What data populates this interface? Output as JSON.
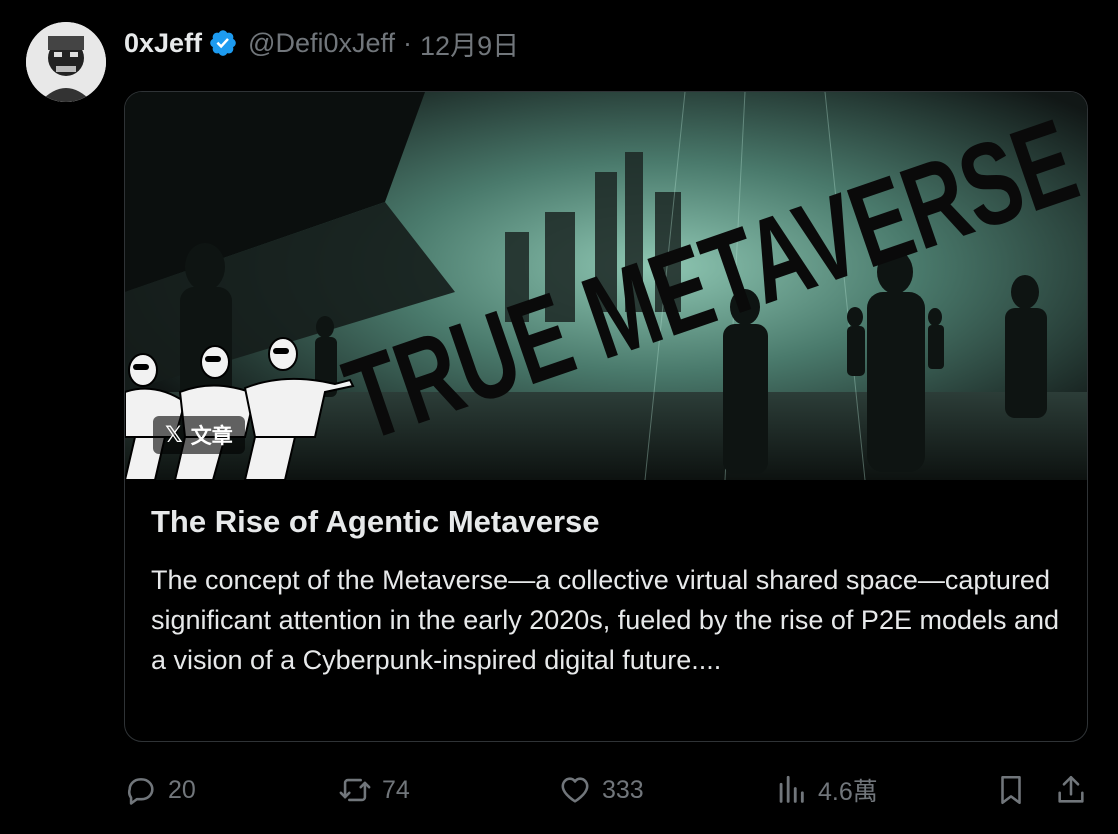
{
  "tweet": {
    "author_name": "0xJeff",
    "handle": "@Defi0xJeff",
    "separator": "·",
    "date": "12月9日",
    "verified": true
  },
  "article": {
    "cover_text": "TRUE METAVERSE",
    "badge_logo": "𝕏",
    "badge_label": "文章",
    "title": "The Rise of Agentic Metaverse",
    "excerpt": "The concept of the Metaverse—a collective virtual shared space—captured significant attention in the early 2020s, fueled by the rise of P2E models and a vision of a Cyberpunk-inspired digital future...."
  },
  "actions": {
    "replies": "20",
    "reposts": "74",
    "likes": "333",
    "views": "4.6萬"
  },
  "icons": {
    "verified": "verified-badge-icon",
    "reply": "reply-icon",
    "repost": "repost-icon",
    "like": "heart-icon",
    "views": "bar-chart-icon",
    "bookmark": "bookmark-icon",
    "share": "share-icon"
  },
  "colors": {
    "background": "#000000",
    "text": "#e7e9ea",
    "muted": "#71767b",
    "verified": "#1d9bf0",
    "border": "#2f3336"
  }
}
